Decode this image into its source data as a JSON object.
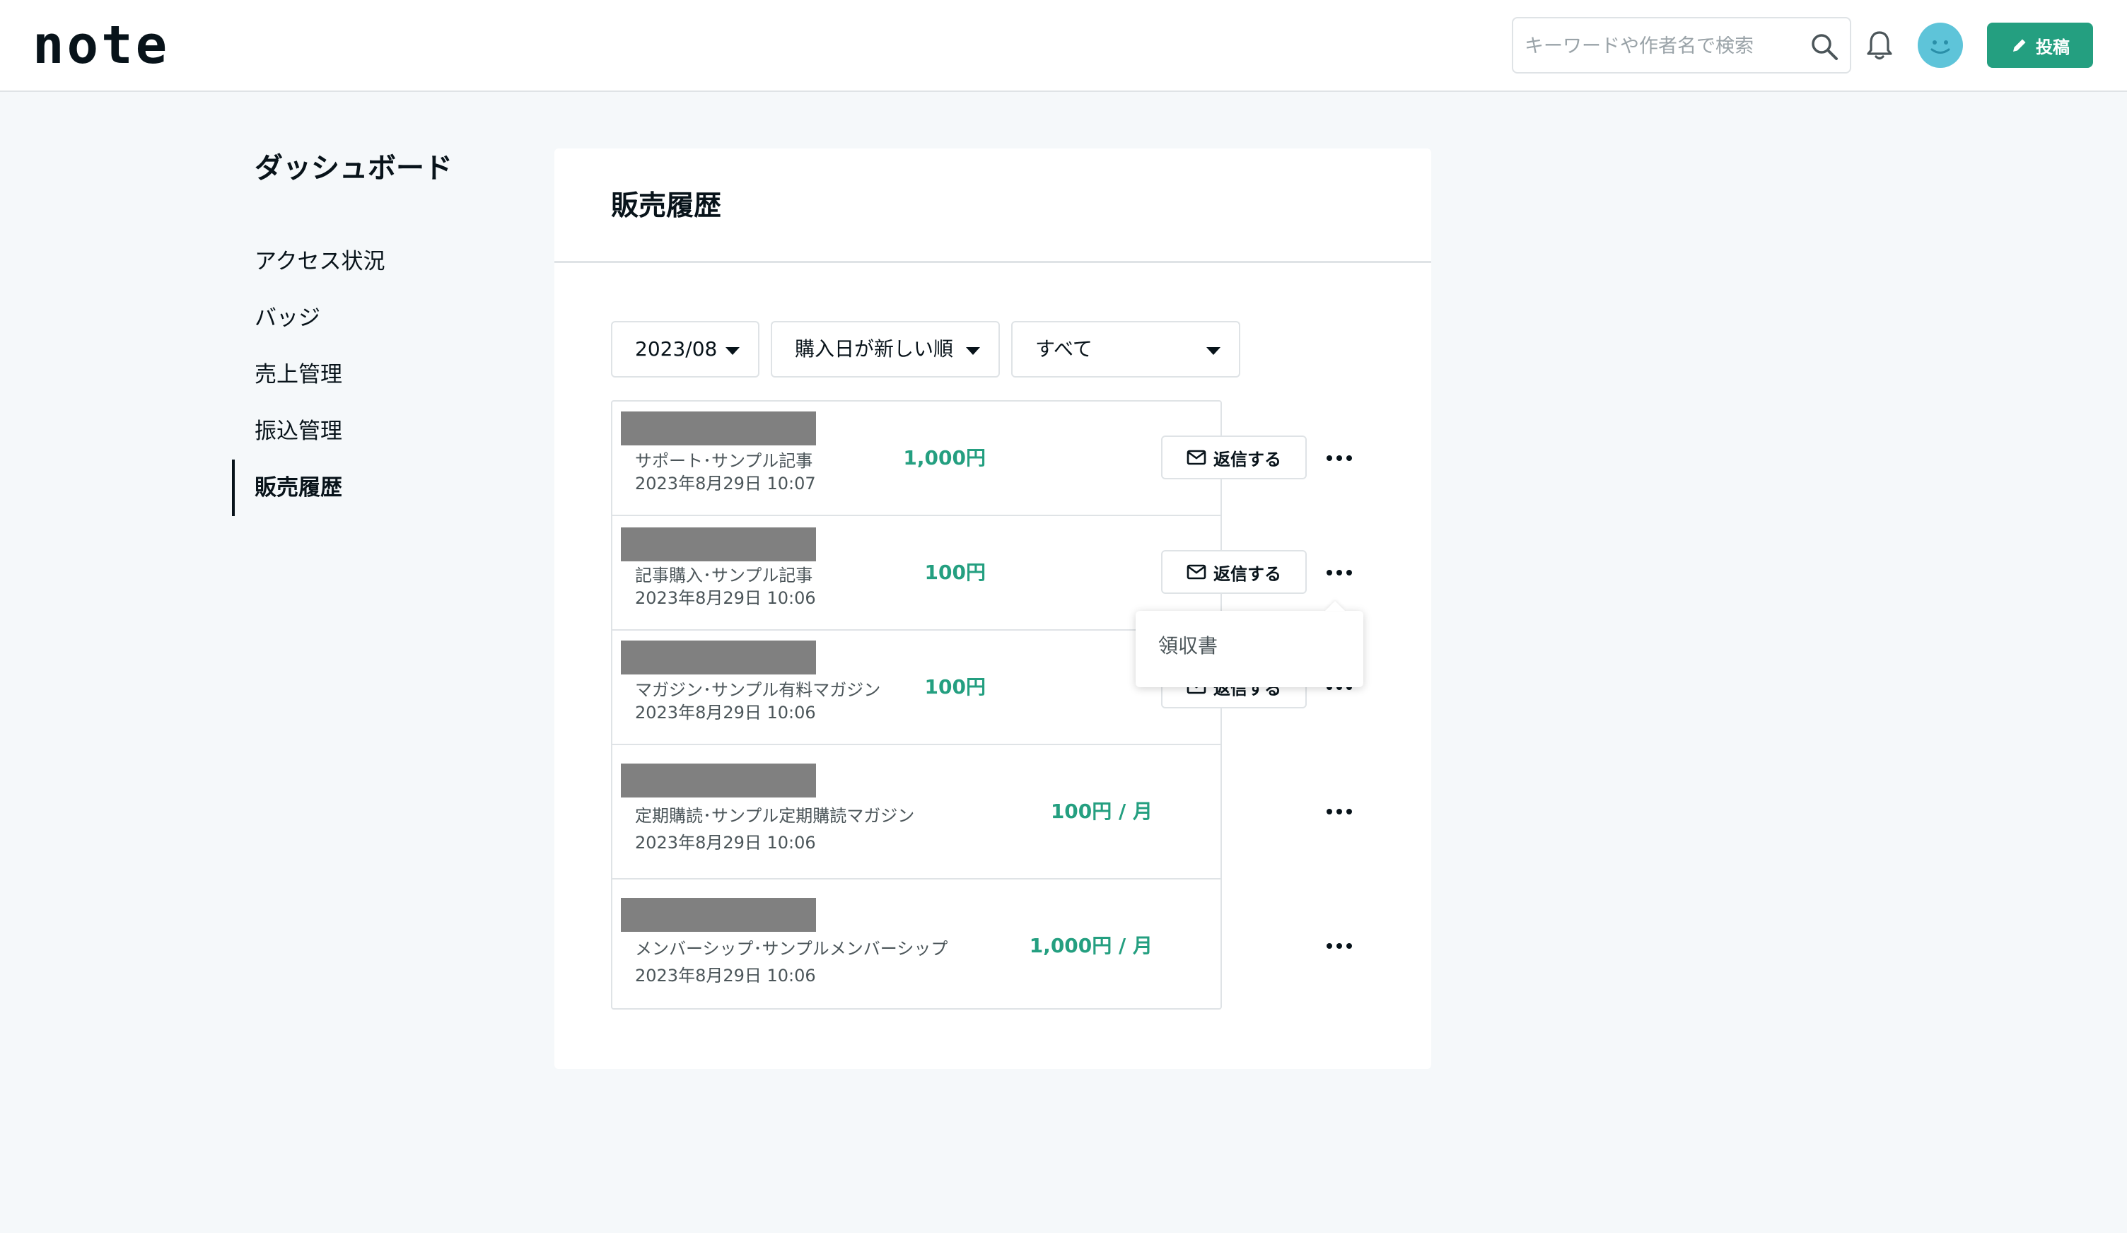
{
  "header": {
    "logo": "note",
    "search_placeholder": "キーワードや作者名で検索",
    "post_label": "投稿"
  },
  "sidebar": {
    "title": "ダッシュボード",
    "items": [
      {
        "label": "アクセス状況",
        "active": false
      },
      {
        "label": "バッジ",
        "active": false
      },
      {
        "label": "売上管理",
        "active": false
      },
      {
        "label": "振込管理",
        "active": false
      },
      {
        "label": "販売履歴",
        "active": true
      }
    ]
  },
  "main": {
    "title": "販売履歴",
    "filters": {
      "month": "2023/08",
      "sort": "購入日が新しい順",
      "type": "すべて"
    },
    "reply_label": "返信する",
    "rows": [
      {
        "desc": "サポート･サンプル記事",
        "date": "2023年8月29日 10:07",
        "price": "1,000円",
        "has_reply": true
      },
      {
        "desc": "記事購入･サンプル記事",
        "date": "2023年8月29日 10:06",
        "price": "100円",
        "has_reply": true
      },
      {
        "desc": "マガジン･サンプル有料マガジン",
        "date": "2023年8月29日 10:06",
        "price": "100円",
        "has_reply": true
      },
      {
        "desc": "定期購読･サンプル定期購読マガジン",
        "date": "2023年8月29日 10:06",
        "price": "100円 / 月",
        "has_reply": false
      },
      {
        "desc": "メンバーシップ･サンプルメンバーシップ",
        "date": "2023年8月29日 10:06",
        "price": "1,000円 / 月",
        "has_reply": false
      }
    ],
    "dropdown": {
      "item": "領収書"
    }
  },
  "colors": {
    "accent": "#249f80",
    "avatar": "#5ec4d9",
    "redaction": "#808080"
  }
}
